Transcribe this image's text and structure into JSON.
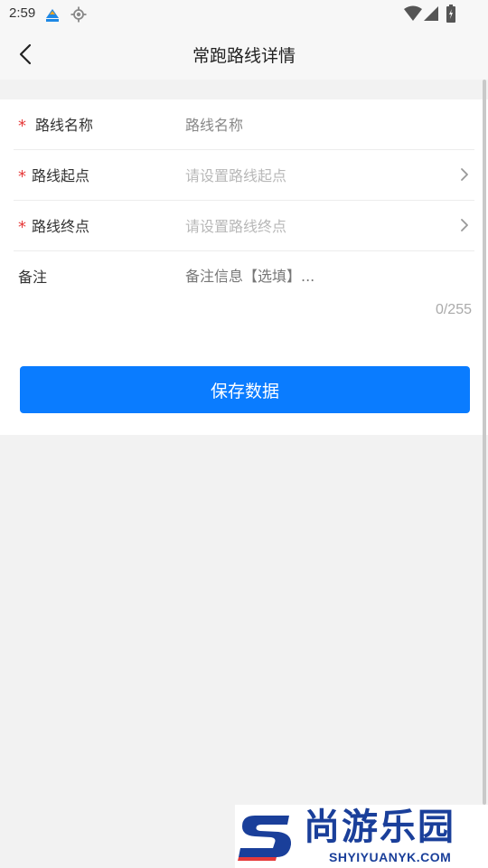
{
  "status_bar": {
    "time": "2:59",
    "icons": [
      "app-notification-icon",
      "gps-icon",
      "wifi-icon",
      "signal-icon",
      "battery-icon"
    ]
  },
  "header": {
    "title": "常跑路线详情",
    "back_icon": "chevron-left-icon"
  },
  "form": {
    "route_name": {
      "label": "路线名称",
      "required": true,
      "placeholder": "路线名称",
      "value": ""
    },
    "route_start": {
      "label": "路线起点",
      "required": true,
      "placeholder": "请设置路线起点"
    },
    "route_end": {
      "label": "路线终点",
      "required": true,
      "placeholder": "请设置路线终点"
    },
    "note": {
      "label": "备注",
      "placeholder": "备注信息【选填】...",
      "value": "",
      "counter": "0/255"
    },
    "required_mark": "*"
  },
  "actions": {
    "save_label": "保存数据"
  },
  "watermark": {
    "name": "尚游乐园",
    "url": "SHYIYUANYK.COM"
  },
  "colors": {
    "primary": "#0a7cff",
    "required": "#e63a3a",
    "background": "#f2f2f2",
    "watermark": "#1a3f9a"
  }
}
